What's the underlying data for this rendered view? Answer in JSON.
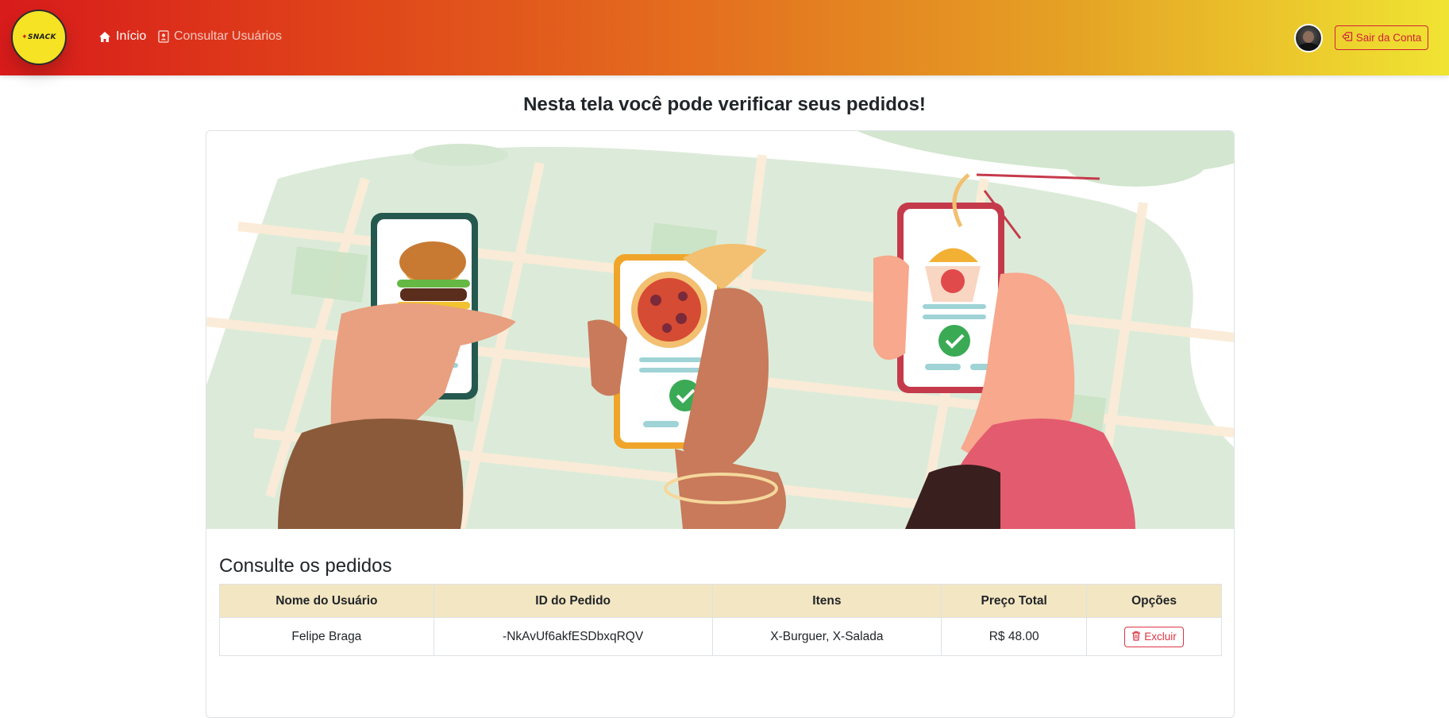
{
  "brand": {
    "logo_text": "SNACK"
  },
  "nav": {
    "home_label": "Início",
    "users_label": "Consultar Usuários"
  },
  "account": {
    "logout_label": "Sair da Conta"
  },
  "page": {
    "heading": "Nesta tela você pode verificar seus pedidos!",
    "section_title": "Consulte os pedidos"
  },
  "table": {
    "headers": [
      "Nome do Usuário",
      "ID do Pedido",
      "Itens",
      "Preço Total",
      "Opções"
    ],
    "rows": [
      {
        "user": "Felipe Braga",
        "order_id": "-NkAvUf6akfESDbxqRQV",
        "items": "X-Burguer, X-Salada",
        "total": "R$ 48.00",
        "action": "Excluir"
      }
    ]
  },
  "colors": {
    "header_gradient_start": "#d81b1b",
    "header_gradient_end": "#f0e432",
    "danger": "#dc3545",
    "table_header_bg": "#f3e6c2"
  }
}
